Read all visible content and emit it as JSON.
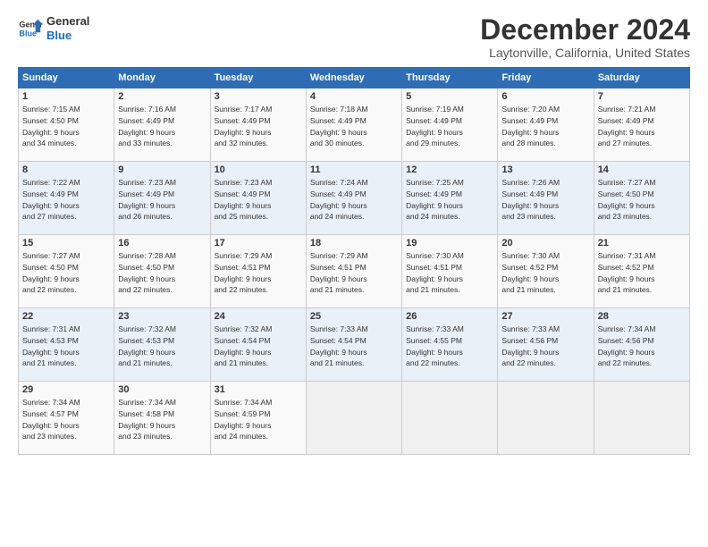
{
  "header": {
    "logo_line1": "General",
    "logo_line2": "Blue",
    "title": "December 2024",
    "subtitle": "Laytonville, California, United States"
  },
  "days_of_week": [
    "Sunday",
    "Monday",
    "Tuesday",
    "Wednesday",
    "Thursday",
    "Friday",
    "Saturday"
  ],
  "weeks": [
    [
      {
        "day": 1,
        "info": "Sunrise: 7:15 AM\nSunset: 4:50 PM\nDaylight: 9 hours\nand 34 minutes."
      },
      {
        "day": 2,
        "info": "Sunrise: 7:16 AM\nSunset: 4:49 PM\nDaylight: 9 hours\nand 33 minutes."
      },
      {
        "day": 3,
        "info": "Sunrise: 7:17 AM\nSunset: 4:49 PM\nDaylight: 9 hours\nand 32 minutes."
      },
      {
        "day": 4,
        "info": "Sunrise: 7:18 AM\nSunset: 4:49 PM\nDaylight: 9 hours\nand 30 minutes."
      },
      {
        "day": 5,
        "info": "Sunrise: 7:19 AM\nSunset: 4:49 PM\nDaylight: 9 hours\nand 29 minutes."
      },
      {
        "day": 6,
        "info": "Sunrise: 7:20 AM\nSunset: 4:49 PM\nDaylight: 9 hours\nand 28 minutes."
      },
      {
        "day": 7,
        "info": "Sunrise: 7:21 AM\nSunset: 4:49 PM\nDaylight: 9 hours\nand 27 minutes."
      }
    ],
    [
      {
        "day": 8,
        "info": "Sunrise: 7:22 AM\nSunset: 4:49 PM\nDaylight: 9 hours\nand 27 minutes."
      },
      {
        "day": 9,
        "info": "Sunrise: 7:23 AM\nSunset: 4:49 PM\nDaylight: 9 hours\nand 26 minutes."
      },
      {
        "day": 10,
        "info": "Sunrise: 7:23 AM\nSunset: 4:49 PM\nDaylight: 9 hours\nand 25 minutes."
      },
      {
        "day": 11,
        "info": "Sunrise: 7:24 AM\nSunset: 4:49 PM\nDaylight: 9 hours\nand 24 minutes."
      },
      {
        "day": 12,
        "info": "Sunrise: 7:25 AM\nSunset: 4:49 PM\nDaylight: 9 hours\nand 24 minutes."
      },
      {
        "day": 13,
        "info": "Sunrise: 7:26 AM\nSunset: 4:49 PM\nDaylight: 9 hours\nand 23 minutes."
      },
      {
        "day": 14,
        "info": "Sunrise: 7:27 AM\nSunset: 4:50 PM\nDaylight: 9 hours\nand 23 minutes."
      }
    ],
    [
      {
        "day": 15,
        "info": "Sunrise: 7:27 AM\nSunset: 4:50 PM\nDaylight: 9 hours\nand 22 minutes."
      },
      {
        "day": 16,
        "info": "Sunrise: 7:28 AM\nSunset: 4:50 PM\nDaylight: 9 hours\nand 22 minutes."
      },
      {
        "day": 17,
        "info": "Sunrise: 7:29 AM\nSunset: 4:51 PM\nDaylight: 9 hours\nand 22 minutes."
      },
      {
        "day": 18,
        "info": "Sunrise: 7:29 AM\nSunset: 4:51 PM\nDaylight: 9 hours\nand 21 minutes."
      },
      {
        "day": 19,
        "info": "Sunrise: 7:30 AM\nSunset: 4:51 PM\nDaylight: 9 hours\nand 21 minutes."
      },
      {
        "day": 20,
        "info": "Sunrise: 7:30 AM\nSunset: 4:52 PM\nDaylight: 9 hours\nand 21 minutes."
      },
      {
        "day": 21,
        "info": "Sunrise: 7:31 AM\nSunset: 4:52 PM\nDaylight: 9 hours\nand 21 minutes."
      }
    ],
    [
      {
        "day": 22,
        "info": "Sunrise: 7:31 AM\nSunset: 4:53 PM\nDaylight: 9 hours\nand 21 minutes."
      },
      {
        "day": 23,
        "info": "Sunrise: 7:32 AM\nSunset: 4:53 PM\nDaylight: 9 hours\nand 21 minutes."
      },
      {
        "day": 24,
        "info": "Sunrise: 7:32 AM\nSunset: 4:54 PM\nDaylight: 9 hours\nand 21 minutes."
      },
      {
        "day": 25,
        "info": "Sunrise: 7:33 AM\nSunset: 4:54 PM\nDaylight: 9 hours\nand 21 minutes."
      },
      {
        "day": 26,
        "info": "Sunrise: 7:33 AM\nSunset: 4:55 PM\nDaylight: 9 hours\nand 22 minutes."
      },
      {
        "day": 27,
        "info": "Sunrise: 7:33 AM\nSunset: 4:56 PM\nDaylight: 9 hours\nand 22 minutes."
      },
      {
        "day": 28,
        "info": "Sunrise: 7:34 AM\nSunset: 4:56 PM\nDaylight: 9 hours\nand 22 minutes."
      }
    ],
    [
      {
        "day": 29,
        "info": "Sunrise: 7:34 AM\nSunset: 4:57 PM\nDaylight: 9 hours\nand 23 minutes."
      },
      {
        "day": 30,
        "info": "Sunrise: 7:34 AM\nSunset: 4:58 PM\nDaylight: 9 hours\nand 23 minutes."
      },
      {
        "day": 31,
        "info": "Sunrise: 7:34 AM\nSunset: 4:59 PM\nDaylight: 9 hours\nand 24 minutes."
      },
      {
        "day": null,
        "info": ""
      },
      {
        "day": null,
        "info": ""
      },
      {
        "day": null,
        "info": ""
      },
      {
        "day": null,
        "info": ""
      }
    ]
  ]
}
